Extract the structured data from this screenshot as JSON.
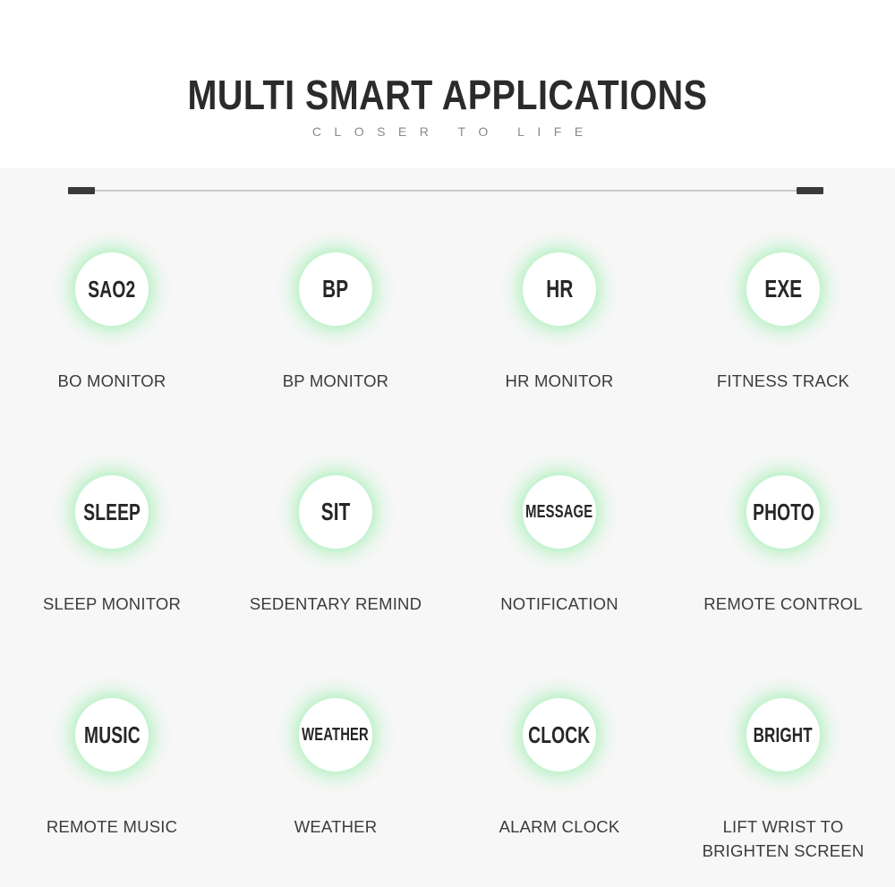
{
  "header": {
    "title": "MULTI SMART APPLICATIONS",
    "subtitle": "CLOSER TO LIFE"
  },
  "divider": {
    "line_color": "#c9c9c9",
    "cap_color": "#3a3a3a"
  },
  "theme": {
    "page_background": "#f7f7f7",
    "header_background": "#ffffff",
    "glow_color": "#7ee896",
    "icon_circle_color": "#ffffff",
    "icon_text_color": "#262626",
    "label_text_color": "#3c3c3c",
    "title_color": "#2b2b2b",
    "subtitle_color": "#8a8a8a"
  },
  "features": [
    [
      {
        "icon_text": "SAO2",
        "icon_size": "s-lg",
        "label": "BO MONITOR",
        "icon_name": "sao2-icon"
      },
      {
        "icon_text": "BP",
        "icon_size": "s-xl",
        "label": "BP MONITOR",
        "icon_name": "bp-icon"
      },
      {
        "icon_text": "HR",
        "icon_size": "s-xl",
        "label": "HR MONITOR",
        "icon_name": "hr-icon"
      },
      {
        "icon_text": "EXE",
        "icon_size": "s-xl",
        "label": "FITNESS TRACK",
        "icon_name": "exe-icon"
      }
    ],
    [
      {
        "icon_text": "SLEEP",
        "icon_size": "s-lg",
        "label": "SLEEP MONITOR",
        "icon_name": "sleep-icon"
      },
      {
        "icon_text": "SIT",
        "icon_size": "s-xl",
        "label": "SEDENTARY REMIND",
        "icon_name": "sit-icon"
      },
      {
        "icon_text": "MESSAGE",
        "icon_size": "s-sm",
        "label": "NOTIFICATION",
        "icon_name": "message-icon"
      },
      {
        "icon_text": "PHOTO",
        "icon_size": "s-lg",
        "label": "REMOTE CONTROL",
        "icon_name": "photo-icon"
      }
    ],
    [
      {
        "icon_text": "MUSIC",
        "icon_size": "s-lg",
        "label": "REMOTE MUSIC",
        "icon_name": "music-icon"
      },
      {
        "icon_text": "WEATHER",
        "icon_size": "s-sm",
        "label": "WEATHER",
        "icon_name": "weather-icon"
      },
      {
        "icon_text": "CLOCK",
        "icon_size": "s-lg",
        "label": "ALARM CLOCK",
        "icon_name": "clock-icon"
      },
      {
        "icon_text": "BRIGHT",
        "icon_size": "s-md",
        "label": "LIFT WRIST TO BRIGHTEN SCREEN",
        "icon_name": "bright-icon"
      }
    ]
  ]
}
